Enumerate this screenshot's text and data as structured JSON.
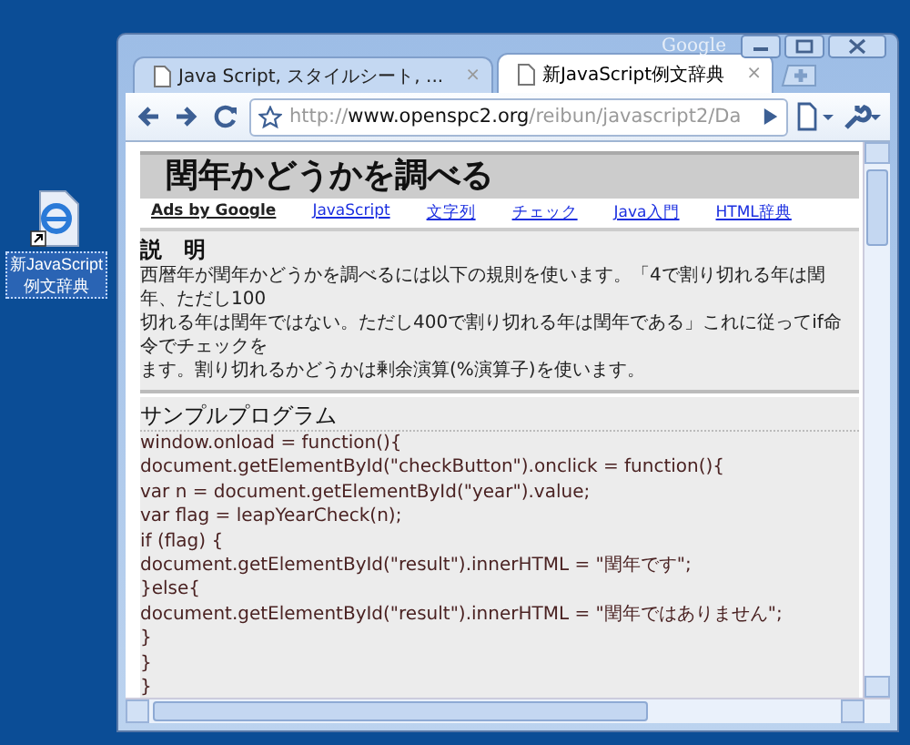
{
  "desktop_icon": {
    "label_lines": [
      "新JavaScript",
      "例文辞典"
    ],
    "selected": true
  },
  "window": {
    "brand": "Google"
  },
  "tabs": [
    {
      "title": "Java Script, スタイルシート, ...",
      "selected": false,
      "close": "×"
    },
    {
      "title": "新JavaScript例文辞典",
      "selected": true,
      "close": "×"
    }
  ],
  "address": {
    "scheme": "http://",
    "host": "www.openspc2.org",
    "path": "/reibun/javascript2/Da"
  },
  "page": {
    "title": "閏年かどうかを調べる",
    "ads_label": "Ads by Google",
    "links": [
      "JavaScript",
      "文字列",
      "チェック",
      "Java入門",
      "HTML辞典"
    ],
    "sections": [
      {
        "kind": "text",
        "heading": "説　明",
        "lines": [
          "西暦年が閏年かどうかを調べるには以下の規則を使います。「4で割り切れる年は閏年、ただし100",
          "切れる年は閏年ではない。ただし400で割り切れる年は閏年である」これに従ってif命令でチェックを",
          "ます。割り切れるかどうかは剰余演算(%演算子)を使います。"
        ]
      },
      {
        "kind": "code",
        "heading": "サンプルプログラム",
        "lines": [
          "window.onload = function(){",
          "document.getElementById(\"checkButton\").onclick = function(){",
          "var n = document.getElementById(\"year\").value;",
          "var flag = leapYearCheck(n);",
          "if (flag) {",
          "document.getElementById(\"result\").innerHTML = \"閏年です\";",
          "}else{",
          "document.getElementById(\"result\").innerHTML = \"閏年ではありません\";",
          "}",
          "}",
          "}"
        ]
      }
    ]
  }
}
